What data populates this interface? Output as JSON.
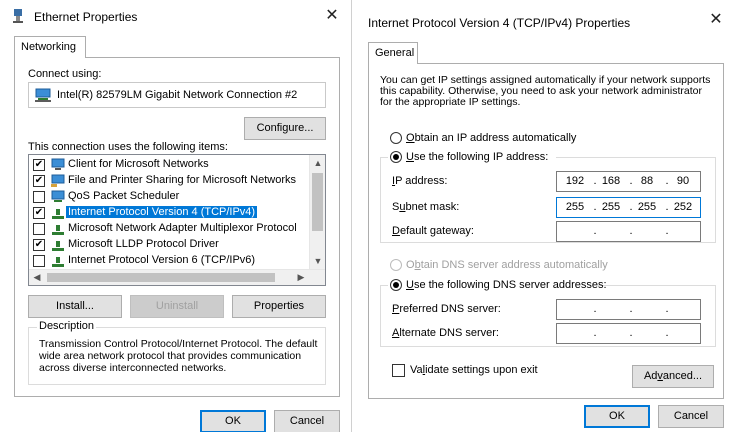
{
  "ethernet": {
    "title": "Ethernet Properties",
    "close": "✕",
    "tab": "Networking",
    "connect_using_label": "Connect using:",
    "adapter_name": "Intel(R) 82579LM Gigabit Network Connection #2",
    "configure_label": "Configure...",
    "items_label": "This connection uses the following items:",
    "items": [
      {
        "label": "Client for Microsoft Networks",
        "checked": true,
        "icon": "network-client-icon"
      },
      {
        "label": "File and Printer Sharing for Microsoft Networks",
        "checked": true,
        "icon": "network-share-icon"
      },
      {
        "label": "QoS Packet Scheduler",
        "checked": false,
        "icon": "network-service-icon"
      },
      {
        "label": "Internet Protocol Version 4 (TCP/IPv4)",
        "checked": true,
        "icon": "protocol-icon",
        "selected": true
      },
      {
        "label": "Microsoft Network Adapter Multiplexor Protocol",
        "checked": false,
        "icon": "protocol-icon"
      },
      {
        "label": "Microsoft LLDP Protocol Driver",
        "checked": true,
        "icon": "protocol-icon"
      },
      {
        "label": "Internet Protocol Version 6 (TCP/IPv6)",
        "checked": false,
        "icon": "protocol-icon"
      }
    ],
    "install_label": "Install...",
    "uninstall_label": "Uninstall",
    "properties_label": "Properties",
    "description_title": "Description",
    "description_text": "Transmission Control Protocol/Internet Protocol. The default wide area network protocol that provides communication across diverse interconnected networks.",
    "ok_label": "OK",
    "cancel_label": "Cancel"
  },
  "ipv4": {
    "title": "Internet Protocol Version 4 (TCP/IPv4) Properties",
    "close": "✕",
    "tab": "General",
    "intro_text": "You can get IP settings assigned automatically if your network supports this capability. Otherwise, you need to ask your network administrator for the appropriate IP settings.",
    "obtain_ip_auto": {
      "pre": "",
      "acc": "O",
      "post": "btain an IP address automatically"
    },
    "use_following_ip": {
      "pre": "",
      "acc": "U",
      "post": "se the following IP address:"
    },
    "ip_address_label": {
      "pre": "",
      "acc": "I",
      "post": "P address:"
    },
    "ip_address": [
      "192",
      "168",
      "88",
      "90"
    ],
    "subnet_label": {
      "pre": "S",
      "acc": "u",
      "post": "bnet mask:"
    },
    "subnet_mask": [
      "255",
      "255",
      "255",
      "252"
    ],
    "gateway_label": {
      "pre": "",
      "acc": "D",
      "post": "efault gateway:"
    },
    "gateway": [
      "",
      "",
      "",
      ""
    ],
    "obtain_dns_auto": {
      "pre": "O",
      "acc": "b",
      "post": "tain DNS server address automatically"
    },
    "use_following_dns": {
      "pre": "",
      "acc": "U",
      "post": "se the following DNS server addresses:"
    },
    "preferred_dns_label": {
      "pre": "",
      "acc": "P",
      "post": "referred DNS server:"
    },
    "preferred_dns": [
      "",
      "",
      "",
      ""
    ],
    "alternate_dns_label": {
      "pre": "",
      "acc": "A",
      "post": "lternate DNS server:"
    },
    "alternate_dns": [
      "",
      "",
      "",
      ""
    ],
    "validate_label": {
      "pre": "Va",
      "acc": "l",
      "post": "idate settings upon exit"
    },
    "advanced_label": {
      "pre": "Ad",
      "acc": "v",
      "post": "anced..."
    },
    "ok_label": "OK",
    "cancel_label": "Cancel"
  },
  "colors": {
    "selection": "#0078d7",
    "button_face": "#e1e1e1",
    "focus_border": "#0078d7"
  }
}
